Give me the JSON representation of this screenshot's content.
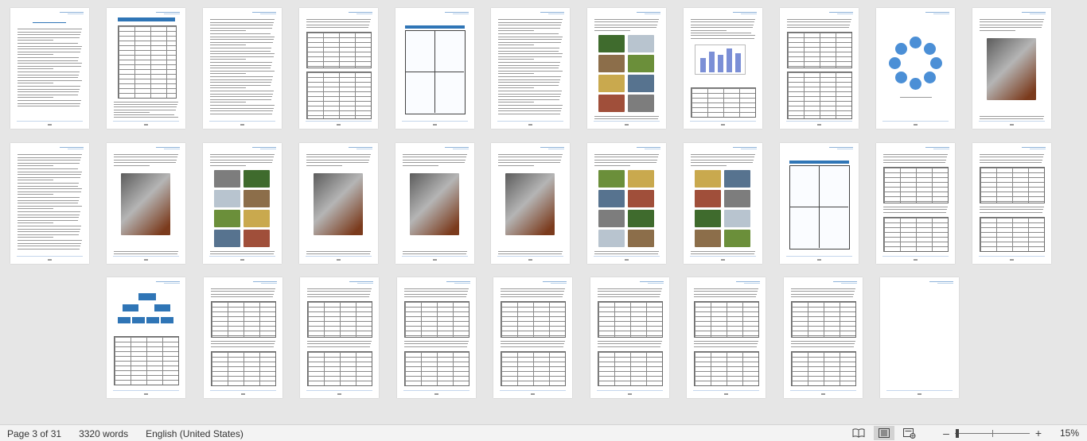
{
  "status_bar": {
    "page_indicator": "Page 3 of 31",
    "word_count": "3320 words",
    "language": "English (United States)",
    "zoom_percent": "15%",
    "zoom_level": 15,
    "view_modes": [
      {
        "name": "read-mode",
        "icon": "book-icon",
        "active": false
      },
      {
        "name": "print-layout",
        "icon": "page-layout-icon",
        "active": true
      },
      {
        "name": "web-layout",
        "icon": "web-layout-icon",
        "active": false
      }
    ]
  },
  "pages": {
    "total": 31,
    "current": 3,
    "rows": 3,
    "columns": 11
  },
  "colors": {
    "workspace": "#e6e6e6",
    "page": "#ffffff",
    "accent_blue": "#2f75b6",
    "highlight_yellow": "#f4f100",
    "status_bar": "#f3f3f3"
  }
}
